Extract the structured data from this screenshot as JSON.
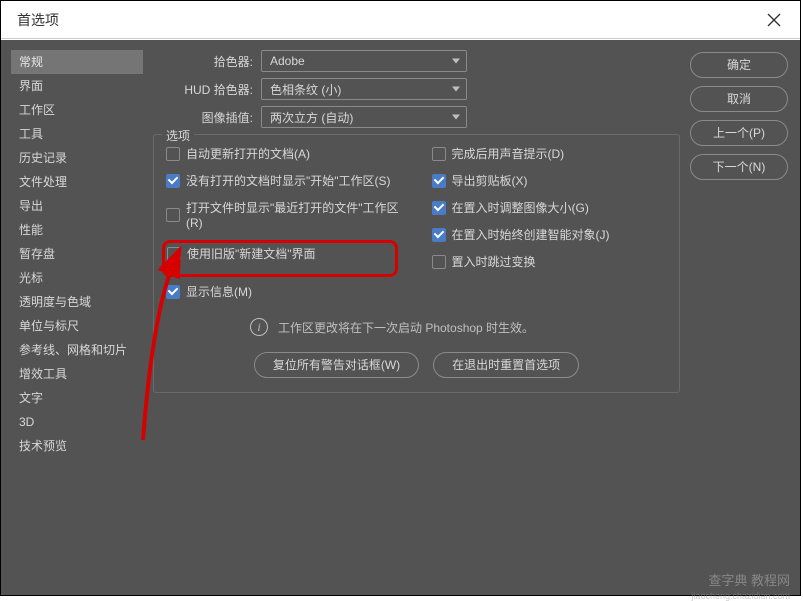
{
  "window": {
    "title": "首选项"
  },
  "sidebar": {
    "items": [
      "常规",
      "界面",
      "工作区",
      "工具",
      "历史记录",
      "文件处理",
      "导出",
      "性能",
      "暂存盘",
      "光标",
      "透明度与色域",
      "单位与标尺",
      "参考线、网格和切片",
      "增效工具",
      "文字",
      "3D",
      "技术预览"
    ],
    "selected_index": 0
  },
  "buttons": {
    "ok": "确定",
    "cancel": "取消",
    "prev": "上一个(P)",
    "next": "下一个(N)"
  },
  "pickers": {
    "color_picker_label": "拾色器:",
    "color_picker_value": "Adobe",
    "hud_label": "HUD 拾色器:",
    "hud_value": "色相条纹 (小)",
    "interp_label": "图像插值:",
    "interp_value": "两次立方 (自动)"
  },
  "options": {
    "legend": "选项",
    "left": [
      {
        "label": "自动更新打开的文档(A)",
        "checked": false
      },
      {
        "label": "没有打开的文档时显示\"开始\"工作区(S)",
        "checked": true
      },
      {
        "label": "打开文件时显示\"最近打开的文件\"工作区(R)",
        "checked": false
      },
      {
        "label": "使用旧版\"新建文档\"界面",
        "checked": false,
        "highlight": true
      },
      {
        "label": "显示信息(M)",
        "checked": true
      }
    ],
    "right": [
      {
        "label": "完成后用声音提示(D)",
        "checked": false
      },
      {
        "label": "导出剪贴板(X)",
        "checked": true
      },
      {
        "label": "在置入时调整图像大小(G)",
        "checked": true
      },
      {
        "label": "在置入时始终创建智能对象(J)",
        "checked": true
      },
      {
        "label": "置入时跳过变换",
        "checked": false
      }
    ],
    "info_text": "工作区更改将在下一次启动 Photoshop 时生效。"
  },
  "bottom": {
    "reset_dialogs": "复位所有警告对话框(W)",
    "reset_on_quit": "在退出时重置首选项"
  },
  "watermark": {
    "main": "查字典 教程网",
    "sub": "jiaocheng.chazidian.com"
  }
}
